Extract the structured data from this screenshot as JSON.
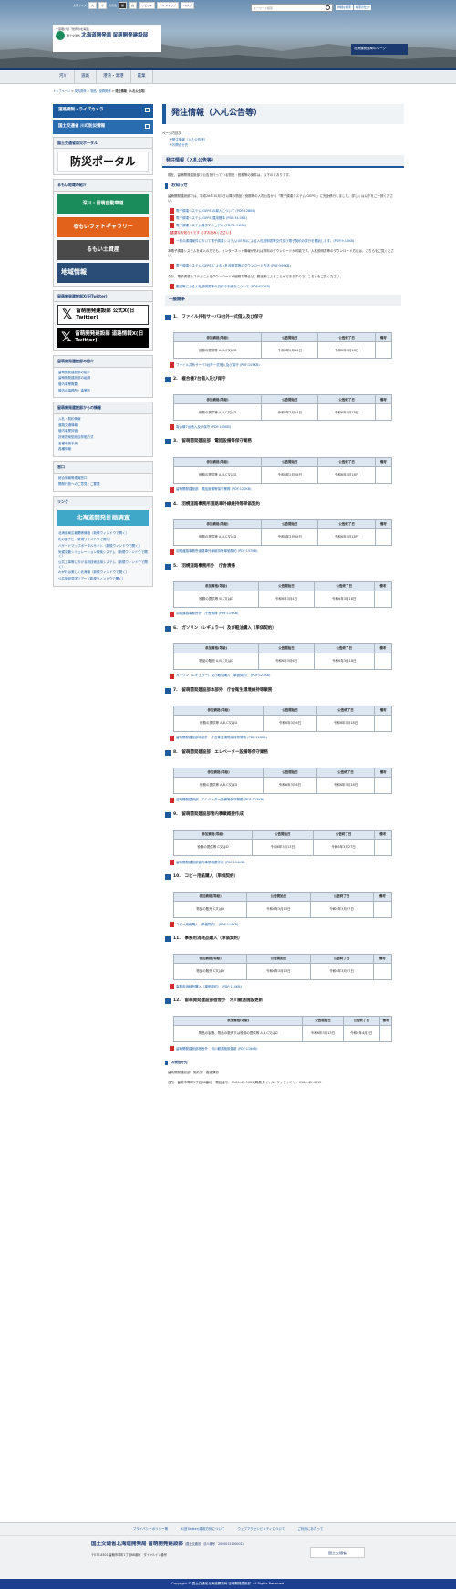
{
  "header": {
    "font_size_label": "文字サイズ",
    "font_sizes": [
      "大",
      "小"
    ],
    "bg_label": "背景色",
    "bg_colors": [
      "黒",
      "白"
    ],
    "reset": "リセット",
    "sitemap": "サイトマップ",
    "help": "ヘルプ",
    "search_placeholder": "キーワード検索",
    "advanced_search": "詳細な検索",
    "how_to_search": "検索の仕方",
    "tagline": "一度覗けば「世界の北海道」",
    "ministry": "国土交通省",
    "bureau": "北海道開発局",
    "office": "留萌開発建設部",
    "banner": "北海道開発局のページ"
  },
  "nav": [
    "河川",
    "道路",
    "港湾・漁港",
    "農業"
  ],
  "breadcrumb": [
    "トップページ",
    "契約関係",
    "物品・役務関係",
    "発注情報（入札公告等）"
  ],
  "sidebar": {
    "btn1": "道路規制・ライブカメラ",
    "btn2": "国土交通省 川の防災情報",
    "bousai_head": "国土交通省防災ポータル",
    "bousai": "防災ポータル",
    "region_head": "るもい地域の紹介",
    "road": "深川・留萌自動車道",
    "photo": "るもいフォトギャラリー",
    "kiyo": "るもい土資産",
    "chiiki": "地域情報",
    "x_head": "留萌開発建設部X(旧Twitter)",
    "x1": "留萌開発建設部 公式X(旧 Twitter)",
    "x2": "留萌開発建設部 道路情報X(旧Twitter)",
    "intro_head": "留萌開発建設部の紹介",
    "intro": [
      "留萌開発建設部の紹介",
      "留萌開発建設部の組織",
      "管内事業概要",
      "管内の事務所・事業所"
    ],
    "info_head": "留萌開発建設部からの情報",
    "info": [
      "入札・契約情報",
      "道路交通情報",
      "管内事業評価",
      "技術提案型総合評価方式",
      "各種申請手続",
      "各種情報"
    ],
    "window_head": "窓口",
    "window": [
      "総合情報等連報窓口",
      "開発行政へのご意見・ご要望"
    ],
    "link_head": "リンク",
    "plan": "北海道開発計画調査",
    "links": [
      "北海道局広報関係情報（新規ウィンドウで開く）",
      "札の道ナビ（新規ウィンドウで開く）",
      "ハザードマップポータルサイト（新規ウィンドウで開く）",
      "気候変動シミュレーション検索システム（新規ウィンドウで開く）",
      "公共工事等における新技術活用システム（新規ウィンドウで開く）",
      "わが村は美しく北海道（新規ウィンドウで開く）",
      "公共施設見学ツアー（新規ウィンドウで開く）"
    ]
  },
  "main": {
    "title": "発注情報（入札公告等）",
    "toc_label": "ページ内目次",
    "toc": [
      "発注情報（入札公告等）",
      "お問合せ先"
    ],
    "h2": "発注情報（入札公告等）",
    "intro": "現在、留萌開発建設部で公告を行っている物品・役務等の案件は、以下のとおりです。",
    "notice_head": "お知らせ",
    "notice_text": "留萌開発建設部では、平成28年10月1日以降の物品・役務等の入札公告から「電子調達システム(GEPS)」に完全移行しました。詳しくは以下をご一読ください。",
    "notice_links": [
      "電子調達システム(GEPS)の導入について (PDF:128KB)",
      "電子調達システム(GEPS)運用基準 (PDF:34.0KB)",
      "電子調達システム操作マニュアル (PDF:1.91MB)"
    ],
    "important": "【重要なお知らせです 必ずお読みください】",
    "important_link": "一部の調達案件において電子調達システム(GEPS)による入札説明書等交付及び電子契約の試行を開始します。(PDF:9.10KB)",
    "important_text": "本電子調達システムを導入の方でも、インターネット情報があれば資料のダウンロードが可能です。入札説明書等のダウンロード方法は、こちらをご覧ください。",
    "dl_link": "電子調達システム(GEPS)による入札説明書等のダウンロード方法 (PDF:599KB)",
    "dl_text": "なお、電子調達システムによるダウンロードが困難な場合は、郵送等によることができますので、こちらをご覧ください。",
    "mail_link": "郵送等による入札説明書等の交付の手続きについて (PDF:637KB)",
    "competition": "一般競争",
    "headers": [
      "参加資格(等級)",
      "公告開始日",
      "公告終了日",
      "備考"
    ],
    "items": [
      {
        "title": "1.　ファイル共有サーバ3台外一式借入及び保守",
        "qual": "役務の提供等 A,B,C又はD",
        "start": "令和6年2月14日",
        "end": "令和6年3月18日",
        "link": "ファイル共有サーバ3台外一式借入及び保守 (PDF:105KB)"
      },
      {
        "title": "2.　複合機7台借入及び保守",
        "qual": "役務の提供等 A,B,C又はD",
        "start": "令和6年2月14日",
        "end": "令和6年3月18日",
        "link": "複合機7台借入及び保守 (PDF:105KB)"
      },
      {
        "title": "3.　留萌開発建設部　電話設備等保守業務",
        "qual": "役務の提供等 A,B,C又はD",
        "start": "令和6年2月28日",
        "end": "令和6年3月18日",
        "link": "留萌開発建設部　電話設備等保守業務 (PDF:120KB)"
      },
      {
        "title": "4.　羽幌道路事務所道路車外線維持等単価契約",
        "qual": "役務の提供等 A,B,C又はD",
        "start": "令和6年2月28日",
        "end": "令和6年3月18日",
        "link": "羽幌道路事務所道路車外線維持等単価契約 (PDF:157KB)"
      },
      {
        "title": "5.　羽幌道路事務所外　庁舎清掃",
        "qual": "役務の提供等 B,C又はD",
        "start": "令和6年3月4日",
        "end": "令和6年3月18日",
        "link": "羽幌道路事務所外　庁舎清掃 (PDF:119KB)"
      },
      {
        "title": "6.　ガソリン（レギュラー）及び軽油購入（単価契約）",
        "qual": "物品の販売 A,B,C又はD",
        "start": "令和6年3月6日",
        "end": "令和6年3月18日",
        "link": "ガソリン（レギュラー）及び軽油購入（単価契約） (PDF:123KB)"
      },
      {
        "title": "7.　留萌開発建設部本部外　庁舎衛生環境維持等業務",
        "qual": "役務の提供等 A,B,C又はD",
        "start": "令和6年3月6日",
        "end": "令和6年3月18日",
        "link": "留萌開発建設部本部外　庁舎衛生環境維持等業務 (PDF:118KB)"
      },
      {
        "title": "8.　留萌開発建設部　エレベーター設備等保守業務",
        "qual": "役務の提供等 A,B,C又はD",
        "start": "令和6年3月6日",
        "end": "令和6年3月18日",
        "link": "留萌開発建設部　エレベーター設備等保守業務 (PDF:123KB)"
      },
      {
        "title": "9.　留萌開発建設部管内事業概要作成",
        "qual": "役務の提供等 C又はD",
        "start": "令和6年3月13日",
        "end": "令和6年3月27日",
        "link": "留萌開発建設部管内事業概要作成 (PDF:104KB)"
      },
      {
        "title": "10.　コピー用紙購入（単価契約）",
        "qual": "物品の販売 C又はD",
        "start": "令和6年3月13日",
        "end": "令和6年3月27日",
        "link": "コピー用紙購入（単価契約） (PDF:114KB)"
      },
      {
        "title": "11.　事務用消耗品購入（単価契約）",
        "qual": "物品の販売 C又はD",
        "start": "令和6年3月13日",
        "end": "令和6年3月27日",
        "link": "事務用消耗品購入（単価契約） (PDF:114KB)"
      },
      {
        "title": "12.　留萌開発建設部宿舎外　河川観測施設更新",
        "qual": "物品の製造、物品の販売又は役務の提供等 A,B,C又はD",
        "start": "令和6年3月13日",
        "end": "令和6年4月2日",
        "link": "留萌開発建設部宿舎外　河川観測施設更新 (PDF:118KB)"
      }
    ],
    "contact_head": "お問合せ先",
    "contact_org": "留萌開発建設部　契約課　審査課係",
    "contact_addr": "住所：留萌市寿町1丁目68番地",
    "contact_tel": "電話番号：0164-42-5631(職員ダイヤル) ファクシミリ：0164-42-4615"
  },
  "footer": {
    "links": [
      "プライバシーポリシー等",
      "X(旧Twitter)運用方針について",
      "ウェブアクセシビリティについて",
      "ご利用にあたって"
    ],
    "org": "国土交通省北海道開発局 留萌開発建設部",
    "corp": "(国土交通省　法人番号　2000012100001)",
    "addr": "〒077-8501 留萌市寿町1丁目68番地",
    "dial": "ダイヤルイン番号",
    "logo": "国土交通省",
    "copyright": "Copyright © 国土交通省北海道開発局 留萌開発建設部. All Rights Reserved."
  }
}
